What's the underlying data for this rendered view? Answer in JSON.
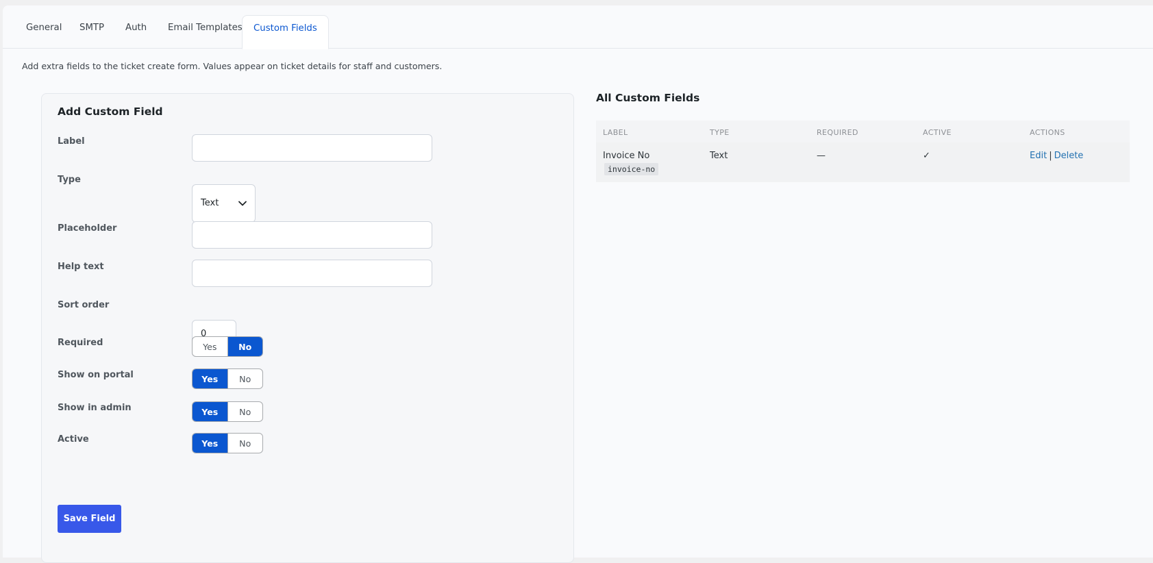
{
  "tabs": [
    {
      "label": "General",
      "active": false
    },
    {
      "label": "SMTP",
      "active": false
    },
    {
      "label": "Auth",
      "active": false
    },
    {
      "label": "Email Templates",
      "active": false
    },
    {
      "label": "Custom Fields",
      "active": true
    }
  ],
  "intro_text": "Add extra fields to the ticket create form. Values appear on ticket details for staff and customers.",
  "form": {
    "title": "Add Custom Field",
    "label_label": "Label",
    "label_value": "",
    "type_label": "Type",
    "type_value": "Text",
    "placeholder_label": "Placeholder",
    "placeholder_value": "",
    "help_label": "Help text",
    "help_value": "",
    "sort_label": "Sort order",
    "sort_value": "0",
    "toggles": [
      {
        "label": "Required",
        "yes": "Yes",
        "no": "No",
        "selected": "No"
      },
      {
        "label": "Show on portal",
        "yes": "Yes",
        "no": "No",
        "selected": "Yes"
      },
      {
        "label": "Show in admin",
        "yes": "Yes",
        "no": "No",
        "selected": "Yes"
      },
      {
        "label": "Active",
        "yes": "Yes",
        "no": "No",
        "selected": "Yes"
      }
    ],
    "save_label": "Save Field"
  },
  "list": {
    "title": "All Custom Fields",
    "headers": [
      "LABEL",
      "TYPE",
      "REQUIRED",
      "ACTIVE",
      "ACTIONS"
    ],
    "rows": [
      {
        "label": "Invoice No",
        "slug": "invoice-no",
        "type": "Text",
        "required": "—",
        "active": "✓",
        "edit": "Edit",
        "separator": "|",
        "delete": "Delete"
      }
    ]
  },
  "colors": {
    "accent": "#0b57d0",
    "primary_button": "#3858e9",
    "link": "#2271b1"
  }
}
